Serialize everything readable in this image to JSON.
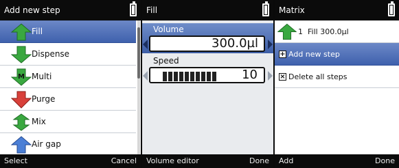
{
  "panel1": {
    "title": "Add new step",
    "items": [
      {
        "label": "Fill",
        "icon": "fill-icon",
        "color": "#3aa840",
        "selected": true
      },
      {
        "label": "Dispense",
        "icon": "dispense-icon",
        "color": "#3aa840",
        "selected": false
      },
      {
        "label": "Multi",
        "icon": "multi-icon",
        "badge": "M",
        "color": "#3aa840",
        "selected": false
      },
      {
        "label": "Purge",
        "icon": "purge-icon",
        "color": "#d8403a",
        "selected": false
      },
      {
        "label": "Mix",
        "icon": "mix-icon",
        "color": "#3aa840",
        "selected": false
      },
      {
        "label": "Air gap",
        "icon": "air-gap-icon",
        "color": "#4b7fd6",
        "selected": false
      }
    ],
    "soft_left": "Select",
    "soft_right": "Cancel"
  },
  "panel2": {
    "title": "Fill",
    "volume_label": "Volume",
    "volume_value": "300.0µl",
    "speed_label": "Speed",
    "speed_value": "10",
    "speed_level": 10,
    "speed_max": 10,
    "soft_left": "Volume editor",
    "soft_right": "Done"
  },
  "panel3": {
    "title": "Matrix",
    "step_number": "1",
    "step_label": "Fill 300.0µl",
    "add_label": "Add new step",
    "add_symbol": "+",
    "delete_label": "Delete all steps",
    "delete_symbol": "×",
    "soft_left": "Add",
    "soft_right": "Done"
  },
  "colors": {
    "selection": "#4a6ab4",
    "fill_green": "#3aa840",
    "purge_red": "#d8403a",
    "airgap_blue": "#4b7fd6"
  }
}
